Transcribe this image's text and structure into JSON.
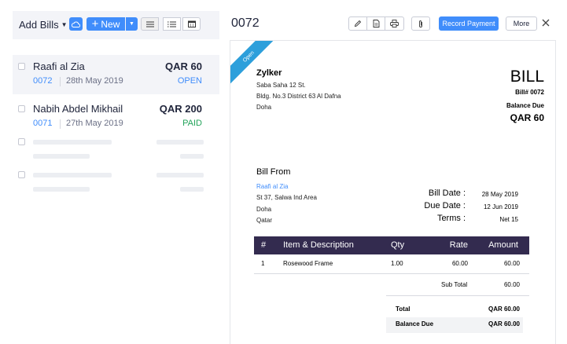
{
  "list_header": {
    "title": "Add Bills",
    "new_label": "New"
  },
  "bills": [
    {
      "vendor": "Raafi al Zia",
      "amount": "QAR 60",
      "number": "0072",
      "date": "28th May 2019",
      "status": "OPEN"
    },
    {
      "vendor": "Nabih Abdel Mikhail",
      "amount": "QAR 200",
      "number": "0071",
      "date": "27th May 2019",
      "status": "PAID"
    }
  ],
  "detail": {
    "title": "0072",
    "record_payment_label": "Record Payment",
    "more_label": "More",
    "ribbon": "Open"
  },
  "document": {
    "from_name": "Zylker",
    "from_lines": [
      "Saba Saha 12 St.",
      "Bldg. No.3 District 63 Al Dafna",
      "Doha"
    ],
    "heading": "BILL",
    "bill_number": "Bill# 0072",
    "balance_due_label": "Balance Due",
    "balance_due_amount": "QAR 60",
    "bill_from_heading": "Bill From",
    "vendor_link": "Raafi al Zia",
    "vendor_address": [
      "St 37, Salwa Ind Area",
      "Doha",
      "Qatar"
    ],
    "meta": [
      {
        "label": "Bill Date :",
        "value": "28 May 2019"
      },
      {
        "label": "Due Date :",
        "value": "12 Jun 2019"
      },
      {
        "label": "Terms :",
        "value": "Net 15"
      }
    ],
    "table_headers": {
      "num": "#",
      "item": "Item & Description",
      "qty": "Qty",
      "rate": "Rate",
      "amount": "Amount"
    },
    "items": [
      {
        "num": "1",
        "item": "Rosewood Frame",
        "qty": "1.00",
        "rate": "60.00",
        "amount": "60.00"
      }
    ],
    "sub_total_label": "Sub Total",
    "sub_total": "60.00",
    "total_label": "Total",
    "total": "QAR 60.00",
    "balance_label": "Balance Due",
    "balance": "QAR 60.00"
  },
  "colors": {
    "accent": "#408dfb",
    "table_header": "#332b4f",
    "ribbon": "#2d9fdb",
    "paid": "#22a35a"
  }
}
